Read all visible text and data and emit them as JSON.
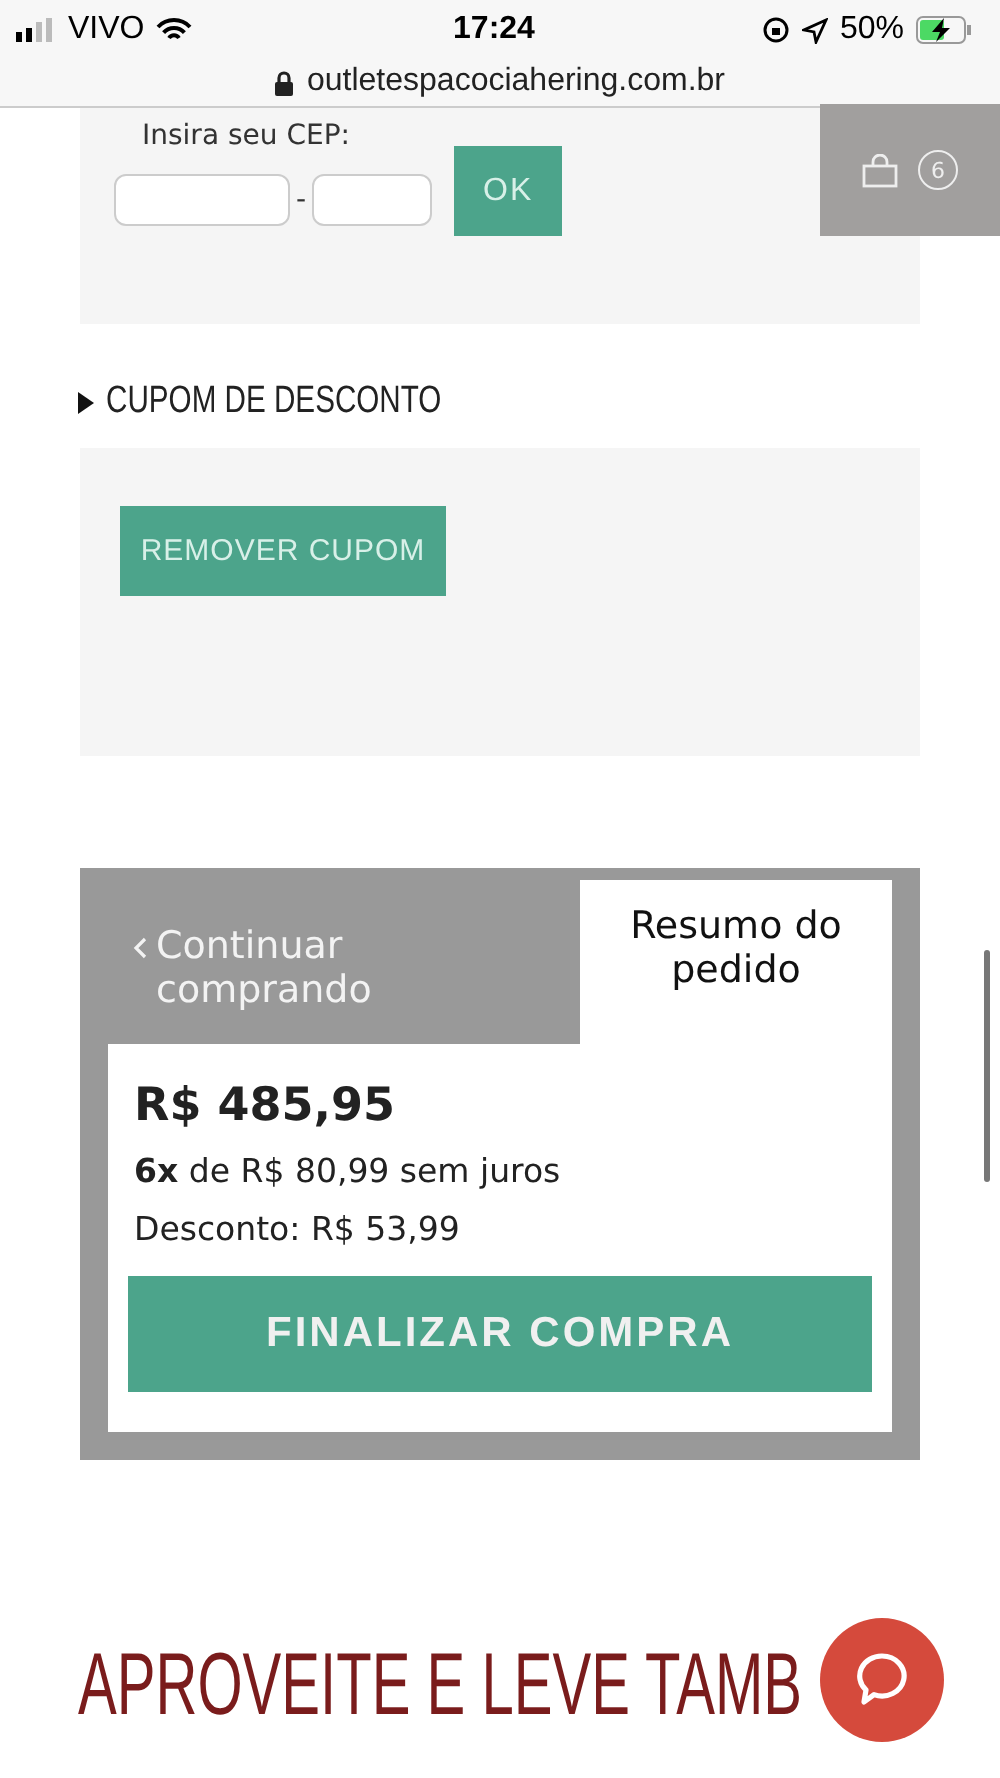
{
  "status_bar": {
    "carrier": "VIVO",
    "time": "17:24",
    "battery": "50%"
  },
  "address_bar": {
    "url": "outletespacociahering.com.br"
  },
  "cep": {
    "label": "Insira seu CEP:",
    "separator": "-",
    "button": "OK"
  },
  "cart": {
    "count": "6"
  },
  "coupon": {
    "heading": "CUPOM DE DESCONTO",
    "button": "REMOVER CUPOM"
  },
  "summary": {
    "tabs": [
      {
        "label": "Continuar comprando",
        "selected": false,
        "kind": "back"
      },
      {
        "label": "Resumo do pedido",
        "selected": true,
        "kind": "plain"
      }
    ],
    "total": "R$ 485,95",
    "installments": "**6x** de R$ 80,99 sem juros",
    "discount": "Desconto: R$ 53,99",
    "checkout": "FINALIZAR COMPRA"
  },
  "related": {
    "heading": "APROVEITE E LEVE TAMB"
  }
}
